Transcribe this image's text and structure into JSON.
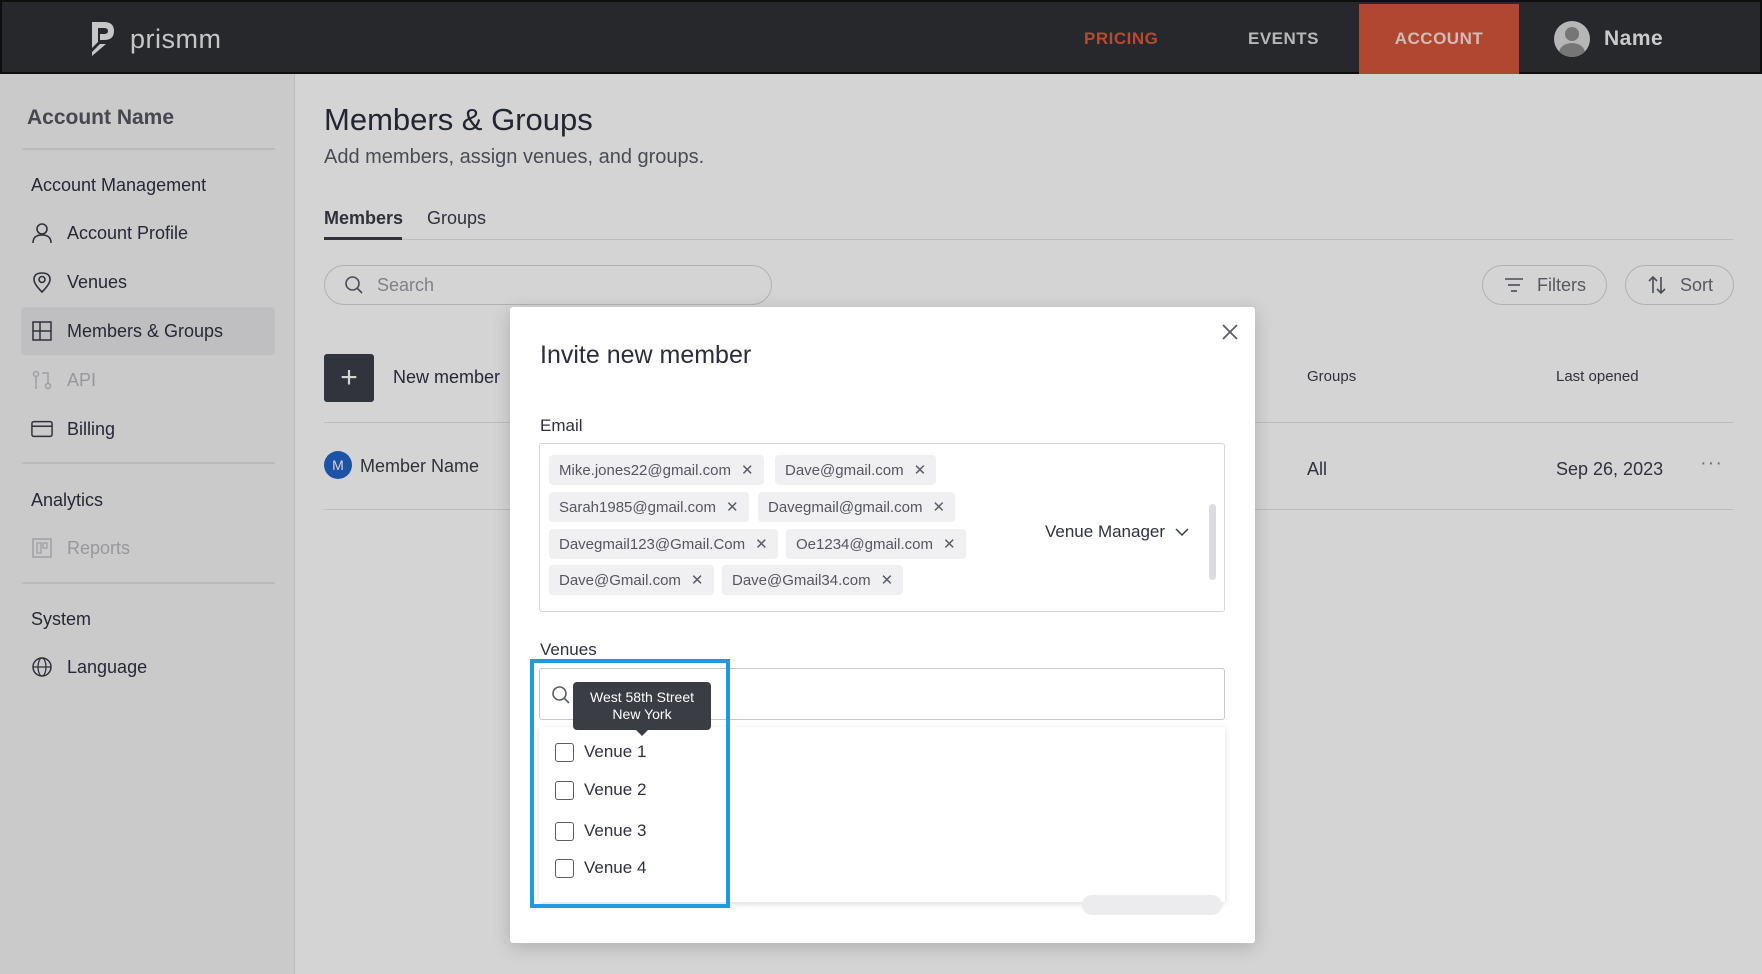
{
  "topbar": {
    "logo_text": "prismm",
    "nav": {
      "pricing": "PRICING",
      "events": "EVENTS",
      "account": "ACCOUNT"
    },
    "user_name": "Name",
    "colors": {
      "background": "#2d2f33",
      "accent": "#d0543a"
    }
  },
  "sidebar": {
    "account_name": "Account Name",
    "sections": [
      {
        "heading": "Account Management"
      },
      {
        "heading": "Analytics"
      },
      {
        "heading": "System"
      }
    ],
    "items": [
      {
        "label": "Account Profile",
        "icon": "user-icon"
      },
      {
        "label": "Venues",
        "icon": "location-pin-icon"
      },
      {
        "label": "Members & Groups",
        "icon": "grid-icon",
        "active": true
      },
      {
        "label": "API",
        "icon": "api-icon",
        "disabled": true
      },
      {
        "label": "Billing",
        "icon": "credit-card-icon"
      },
      {
        "label": "Reports",
        "icon": "reports-icon",
        "disabled": true
      },
      {
        "label": "Language",
        "icon": "globe-icon"
      }
    ]
  },
  "main": {
    "title": "Members & Groups",
    "subtitle": "Add members, assign venues, and groups.",
    "tabs": [
      {
        "label": "Members",
        "active": true
      },
      {
        "label": "Groups"
      }
    ],
    "search_placeholder": "Search",
    "filters_label": "Filters",
    "sort_label": "Sort",
    "new_member_label": "New member",
    "columns": {
      "groups": "Groups",
      "last_opened": "Last opened"
    },
    "rows": [
      {
        "avatar_initial": "M",
        "name": "Member Name",
        "groups": "All",
        "last_opened": "Sep 26, 2023",
        "more": "···"
      }
    ]
  },
  "modal": {
    "title": "Invite new member",
    "email_label": "Email",
    "emails": [
      "Mike.jones22@gmail.com",
      "Dave@gmail.com",
      "Sarah1985@gmail.com",
      "Davegmail@gmail.com",
      "Davegmail123@Gmail.Com",
      "Oe1234@gmail.com",
      "Dave@Gmail.com",
      "Dave@Gmail34.com"
    ],
    "role": "Venue Manager",
    "venues_label": "Venues",
    "venues": [
      "Venue 1",
      "Venue 2",
      "Venue 3",
      "Venue 4"
    ],
    "tooltip": {
      "line1": "West 58th Street",
      "line2": "New York"
    },
    "highlight_color": "#1e9be0"
  }
}
